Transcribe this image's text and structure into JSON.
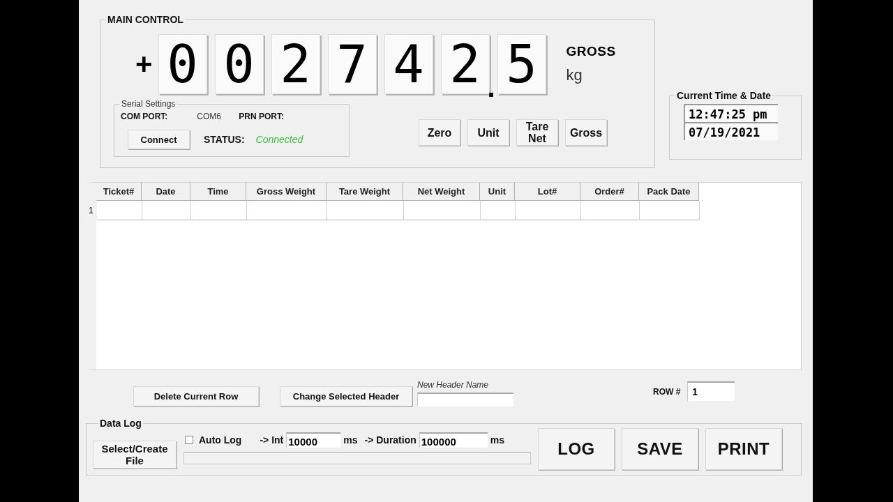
{
  "main_control": {
    "title": "MAIN CONTROL",
    "display": {
      "sign": "+",
      "digits": [
        {
          "kind": "digit",
          "text": "0"
        },
        {
          "kind": "digit",
          "text": "0"
        },
        {
          "kind": "digit",
          "text": "2"
        },
        {
          "kind": "digit",
          "text": "7"
        },
        {
          "kind": "digit",
          "text": "4"
        },
        {
          "kind": "digit",
          "text": "2"
        },
        {
          "kind": "point",
          "text": "."
        },
        {
          "kind": "digit",
          "text": "5"
        }
      ],
      "mode": "GROSS",
      "unit": "kg"
    },
    "serial_settings": {
      "title": "Serial Settings",
      "com_port_label": "COM PORT:",
      "com_port": "COM6",
      "prn_port_label": "PRN PORT:",
      "connect_button": "Connect",
      "status_label": "STATUS:",
      "status": "Connected",
      "connected": true
    },
    "buttons": [
      {
        "label": "Zero"
      },
      {
        "label": "Unit"
      },
      {
        "label": "Tare Net"
      },
      {
        "label": "Gross"
      }
    ]
  },
  "clock": {
    "title": "Current Time & Date",
    "time": "12:47:25 pm",
    "date": "07/19/2021"
  },
  "table": {
    "columns": [
      "Ticket#",
      "Date",
      "Time",
      "Gross Weight",
      "Tare Weight",
      "Net Weight",
      "Unit",
      "Lot#",
      "Order#",
      "Pack Date"
    ],
    "rows": [
      {
        "header": "1"
      }
    ]
  },
  "table_actions": {
    "delete_button": "Delete Current Row",
    "change_header_button": "Change Selected Header",
    "new_header_label": "New Header Name",
    "row_label": "ROW #",
    "row_value": "1"
  },
  "data_log": {
    "title": "Data Log",
    "file_button": "Select/Create File",
    "auto_log": {
      "label": "Auto Log",
      "checked": false
    },
    "int_label": "-> Int",
    "int_value": "10000",
    "int_unit": "ms",
    "duration_label": "-> Duration",
    "duration_value": "100000",
    "duration_unit": "ms",
    "progress": {
      "level": 0
    },
    "buttons": [
      "LOG",
      "SAVE",
      "PRINT"
    ]
  }
}
